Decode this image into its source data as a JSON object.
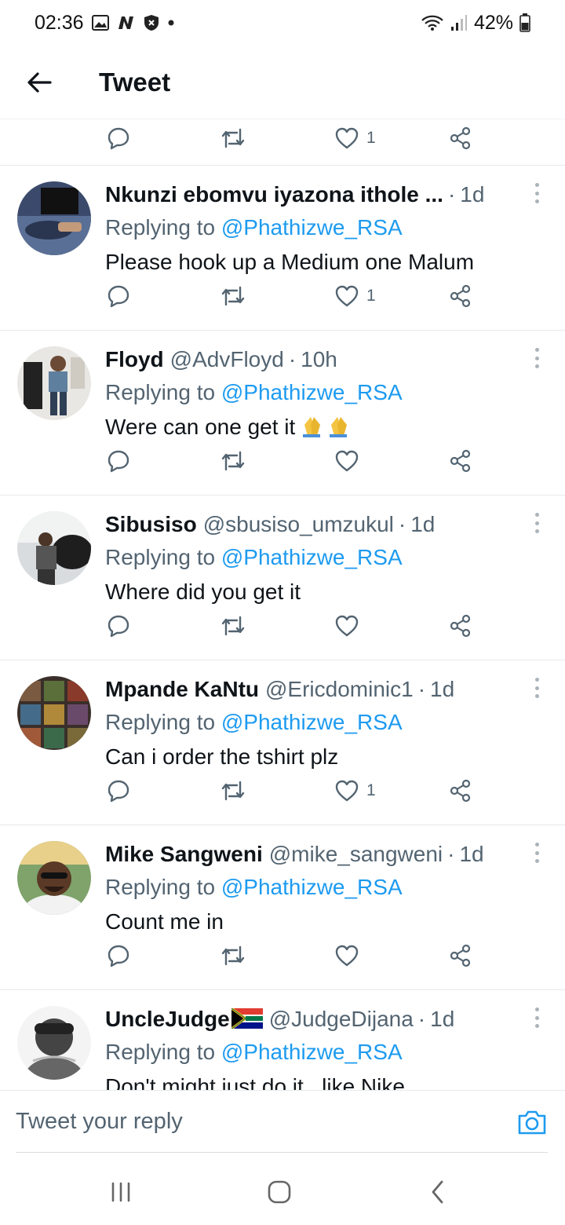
{
  "status_bar": {
    "time": "02:36",
    "battery": "42%",
    "icons_left": [
      "gallery-icon",
      "n-app-icon",
      "shield-icon",
      "dot-icon"
    ],
    "icons_right": [
      "wifi-icon",
      "signal-icon",
      "battery-icon"
    ]
  },
  "header": {
    "title": "Tweet",
    "back_icon": "arrow-left-icon"
  },
  "top_actions": {
    "like_count": "1"
  },
  "tweets": [
    {
      "name": "Nkunzi ebomvu iyazona ithole ...",
      "handle": "",
      "time": "1d",
      "replying_prefix": "Replying to",
      "replying_to": "@Phathizwe_RSA",
      "text": "Please hook up a Medium one Malum",
      "emoji": "",
      "like_count": "1"
    },
    {
      "name": "Floyd",
      "handle": "@AdvFloyd",
      "time": "10h",
      "replying_prefix": "Replying to",
      "replying_to": "@Phathizwe_RSA",
      "text": "Were can one get it",
      "emoji": "🙏🙏",
      "like_count": ""
    },
    {
      "name": "Sibusiso",
      "handle": "@sbusiso_umzukul",
      "time": "1d",
      "replying_prefix": "Replying to",
      "replying_to": "@Phathizwe_RSA",
      "text": "Where did you get it",
      "emoji": "",
      "like_count": ""
    },
    {
      "name": "Mpande KaNtu",
      "handle": "@Ericdominic1",
      "time": "1d",
      "replying_prefix": "Replying to",
      "replying_to": "@Phathizwe_RSA",
      "text": "Can i order the tshirt plz",
      "emoji": "",
      "like_count": "1"
    },
    {
      "name": "Mike Sangweni",
      "handle": "@mike_sangweni",
      "time": "1d",
      "replying_prefix": "Replying to",
      "replying_to": "@Phathizwe_RSA",
      "text": "Count me in",
      "emoji": "",
      "like_count": ""
    },
    {
      "name": "UncleJudge",
      "handle": "@JudgeDijana",
      "time": "1d",
      "replying_prefix": "Replying to",
      "replying_to": "@Phathizwe_RSA",
      "text": "Don't might just do it.. like Nike",
      "emoji": "",
      "like_count": ""
    }
  ],
  "reply_bar": {
    "placeholder": "Tweet your reply",
    "camera_icon": "camera-icon"
  },
  "nav_bar": {
    "recents_icon": "recents-icon",
    "home_icon": "home-icon",
    "back_icon": "nav-back-icon"
  },
  "colors": {
    "accent": "#1d9bf0",
    "text": "#0f1419",
    "secondary": "#536471"
  }
}
